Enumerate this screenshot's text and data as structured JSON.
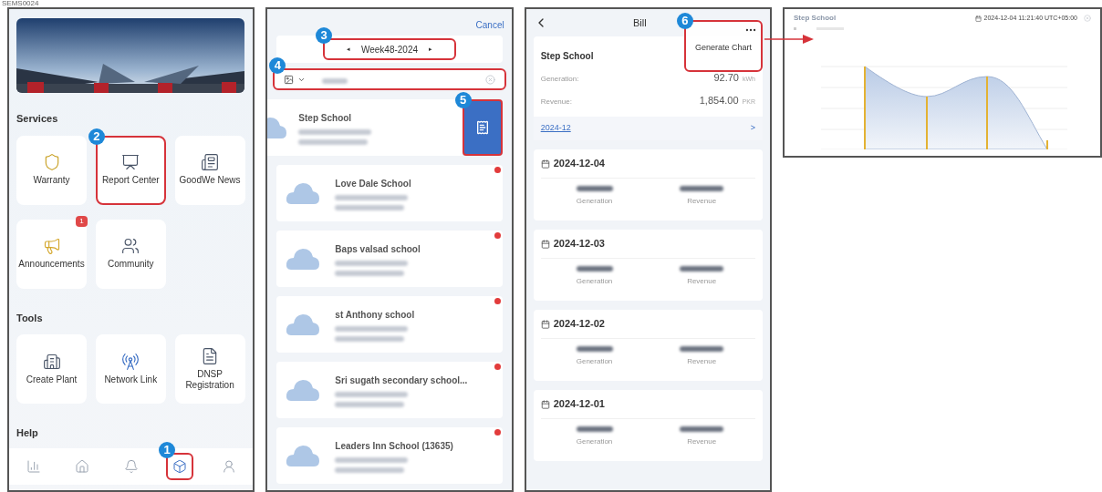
{
  "caption": "SEMS0024",
  "home": {
    "services_title": "Services",
    "services": [
      {
        "label": "Warranty",
        "kind": "shield",
        "highlighted": false
      },
      {
        "label": "Report Center",
        "kind": "report",
        "highlighted": true,
        "step": "2"
      },
      {
        "label": "GoodWe News",
        "kind": "news",
        "highlighted": false
      },
      {
        "label": "Announcements",
        "kind": "megaphone",
        "highlighted": false,
        "badge": "1"
      },
      {
        "label": "Community",
        "kind": "community",
        "highlighted": false
      }
    ],
    "tools_title": "Tools",
    "tools": [
      {
        "label": "Create Plant",
        "kind": "plant",
        "highlighted": false
      },
      {
        "label": "Network Link",
        "kind": "antenna",
        "highlighted": false
      },
      {
        "label": "DNSP Registration",
        "kind": "registration",
        "highlighted": false
      }
    ],
    "help_title": "Help",
    "tabbar": [
      {
        "kind": "chart",
        "selected": false
      },
      {
        "kind": "home",
        "selected": false
      },
      {
        "kind": "bell",
        "selected": false
      },
      {
        "kind": "box",
        "selected": true,
        "step": "1"
      },
      {
        "kind": "user",
        "selected": false
      }
    ]
  },
  "report": {
    "cancel": "Cancel",
    "week": "Week48-2024",
    "week_prev": "◂",
    "week_next": "▸",
    "week_step": "3",
    "search_step": "4",
    "bill_step": "5",
    "plants": [
      {
        "name": "Step School",
        "kind": "swiped"
      },
      {
        "name": "Love Dale School",
        "kind": "normal",
        "unread": true
      },
      {
        "name": "Baps valsad school",
        "kind": "normal",
        "unread": true
      },
      {
        "name": "st Anthony school",
        "kind": "normal",
        "unread": true
      },
      {
        "name": "Sri sugath secondary school...",
        "kind": "normal",
        "unread": true
      },
      {
        "name": "Leaders Inn School (13635)",
        "kind": "normal",
        "unread": true
      }
    ]
  },
  "bill": {
    "title": "Bill",
    "menu_item": "Generate Chart",
    "menu_step": "6",
    "plant": "Step School",
    "generation_label": "Generation:",
    "generation_value": "92.70",
    "generation_unit": "kWh",
    "revenue_label": "Revenue:",
    "revenue_value": "1,854.00",
    "revenue_unit": "PKR",
    "month": "2024-12",
    "month_arrow": ">",
    "days": [
      {
        "date": "2024-12-04",
        "generation": "Generation",
        "revenue": "Revenue"
      },
      {
        "date": "2024-12-03",
        "generation": "Generation",
        "revenue": "Revenue"
      },
      {
        "date": "2024-12-02",
        "generation": "Generation",
        "revenue": "Revenue"
      },
      {
        "date": "2024-12-01",
        "generation": "Generation",
        "revenue": "Revenue"
      }
    ]
  },
  "chart_view": {
    "title": "Step School",
    "timestamp": "2024-12-04 11:21:40 UTC+05:00"
  }
}
